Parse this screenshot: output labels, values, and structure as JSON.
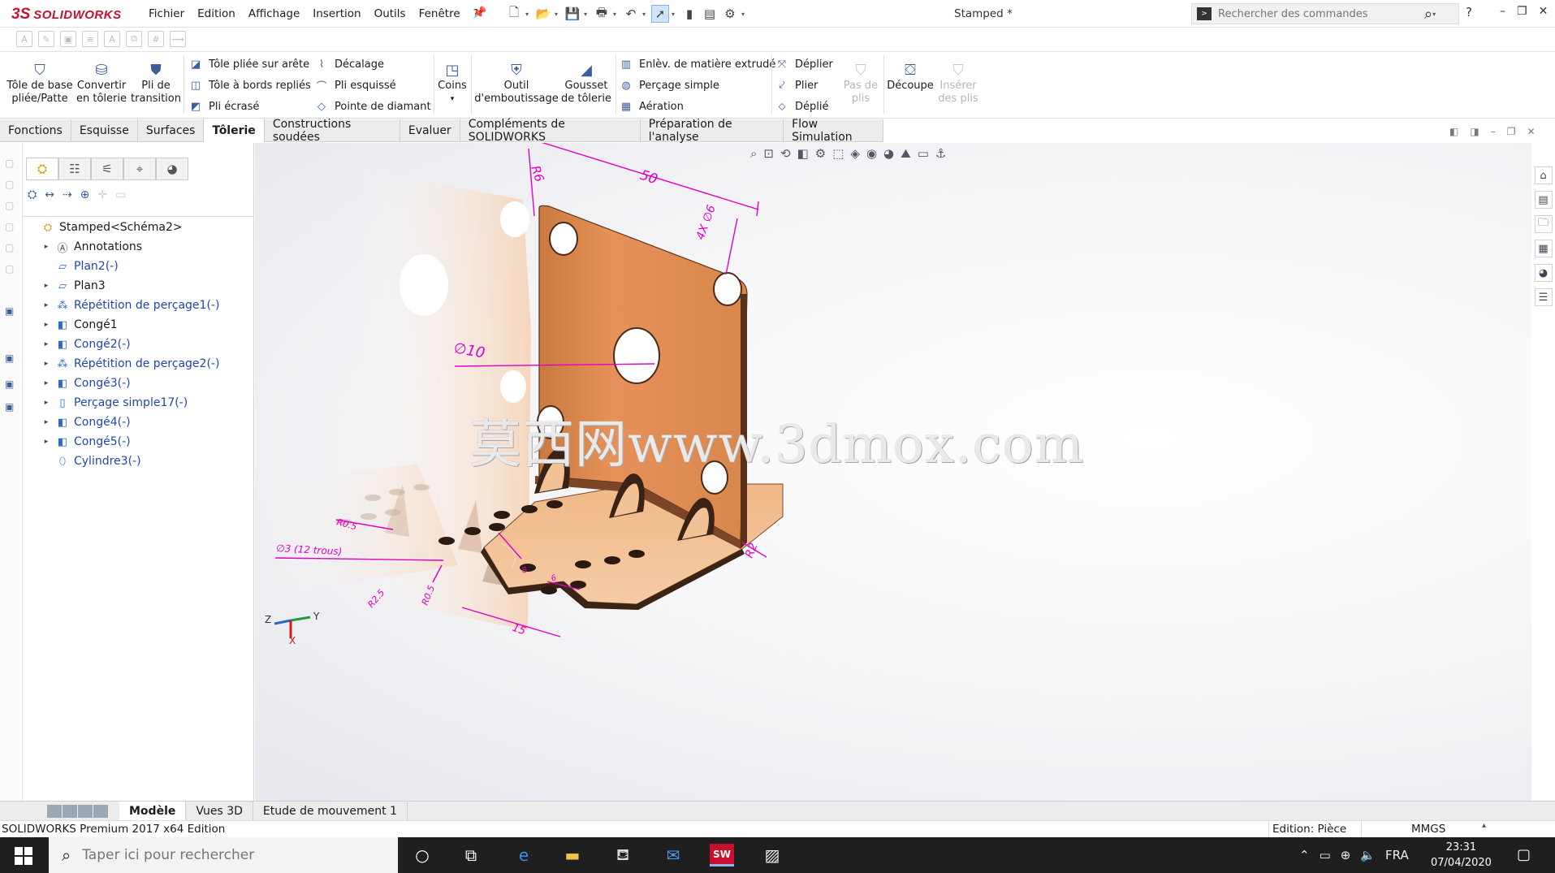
{
  "app": {
    "logo_ds": "3S",
    "logo_word": "SOLIDWORKS",
    "doc_title": "Stamped *",
    "colors": {
      "brand": "#c8102e",
      "accent": "#3b5e9c",
      "tree_blue": "#2047a8",
      "dim_magenta": "#e000c8",
      "part_orange": "#e8955a"
    }
  },
  "menu": [
    "Fichier",
    "Edition",
    "Affichage",
    "Insertion",
    "Outils",
    "Fenêtre",
    "?"
  ],
  "search": {
    "placeholder": "Rechercher des commandes"
  },
  "ribbon": {
    "big_left": [
      {
        "l1": "Tôle de base",
        "l2": "pliée/Patte"
      },
      {
        "l1": "Convertir",
        "l2": "en tôlerie"
      },
      {
        "l1": "Pli de",
        "l2": "transition"
      }
    ],
    "col1": [
      "Tôle pliée sur arête",
      "Tôle à bords repliés",
      "Pli écrasé"
    ],
    "col2": [
      "Décalage",
      "Pli esquissé",
      "Pointe de diamant"
    ],
    "coins": "Coins",
    "outil": {
      "l1": "Outil",
      "l2": "d'emboutissage"
    },
    "gousset": {
      "l1": "Gousset",
      "l2": "de tôlerie"
    },
    "col3": [
      "Enlèv. de matière extrudé",
      "Perçage simple",
      "Aération"
    ],
    "col4": [
      "Déplier",
      "Plier",
      "Déplié"
    ],
    "pas_de_plis": {
      "l1": "Pas de",
      "l2": "plis"
    },
    "decoupe": "Découpe",
    "inserer": {
      "l1": "Insérer",
      "l2": "des plis"
    }
  },
  "tabs": [
    "Fonctions",
    "Esquisse",
    "Surfaces",
    "Tôlerie",
    "Constructions soudées",
    "Evaluer",
    "Compléments de SOLIDWORKS",
    "Préparation de l'analyse",
    "Flow Simulation"
  ],
  "tree": [
    {
      "label": "Stamped<Schéma2>",
      "icon": "part-icon"
    },
    {
      "label": "Annotations",
      "icon": "annotations-icon"
    },
    {
      "label": "Plan2(-)",
      "icon": "plane-icon"
    },
    {
      "label": "Plan3",
      "icon": "plane-icon"
    },
    {
      "label": "Répétition de perçage1(-)",
      "icon": "pattern-icon"
    },
    {
      "label": "Congé1",
      "icon": "fillet-icon"
    },
    {
      "label": "Congé2(-)",
      "icon": "fillet-icon"
    },
    {
      "label": "Répétition de perçage2(-)",
      "icon": "pattern-icon"
    },
    {
      "label": "Congé3(-)",
      "icon": "fillet-icon"
    },
    {
      "label": "Perçage simple17(-)",
      "icon": "hole-icon"
    },
    {
      "label": "Congé4(-)",
      "icon": "fillet-icon"
    },
    {
      "label": "Congé5(-)",
      "icon": "fillet-icon"
    },
    {
      "label": "Cylindre3(-)",
      "icon": "cylinder-icon"
    }
  ],
  "dimensions": [
    "50",
    "R6",
    "4X ∅6",
    "∅10",
    "R0.5",
    "∅3 (12 trous)",
    "R2",
    "R0.5",
    "R2.5",
    "15",
    "6",
    "8"
  ],
  "watermark": "莫西网www.3dmox.com",
  "triad": {
    "z": "Z",
    "y": "Y",
    "x": "X"
  },
  "bottom_tabs": [
    "Modèle",
    "Vues 3D",
    "Etude de mouvement 1"
  ],
  "status": {
    "edition": "SOLIDWORKS Premium 2017 x64 Edition",
    "mode": "Edition: Pièce",
    "units": "MMGS"
  },
  "taskbar": {
    "search_placeholder": "Taper ici pour rechercher",
    "lang": "FRA",
    "time": "23:31",
    "date": "07/04/2020"
  }
}
